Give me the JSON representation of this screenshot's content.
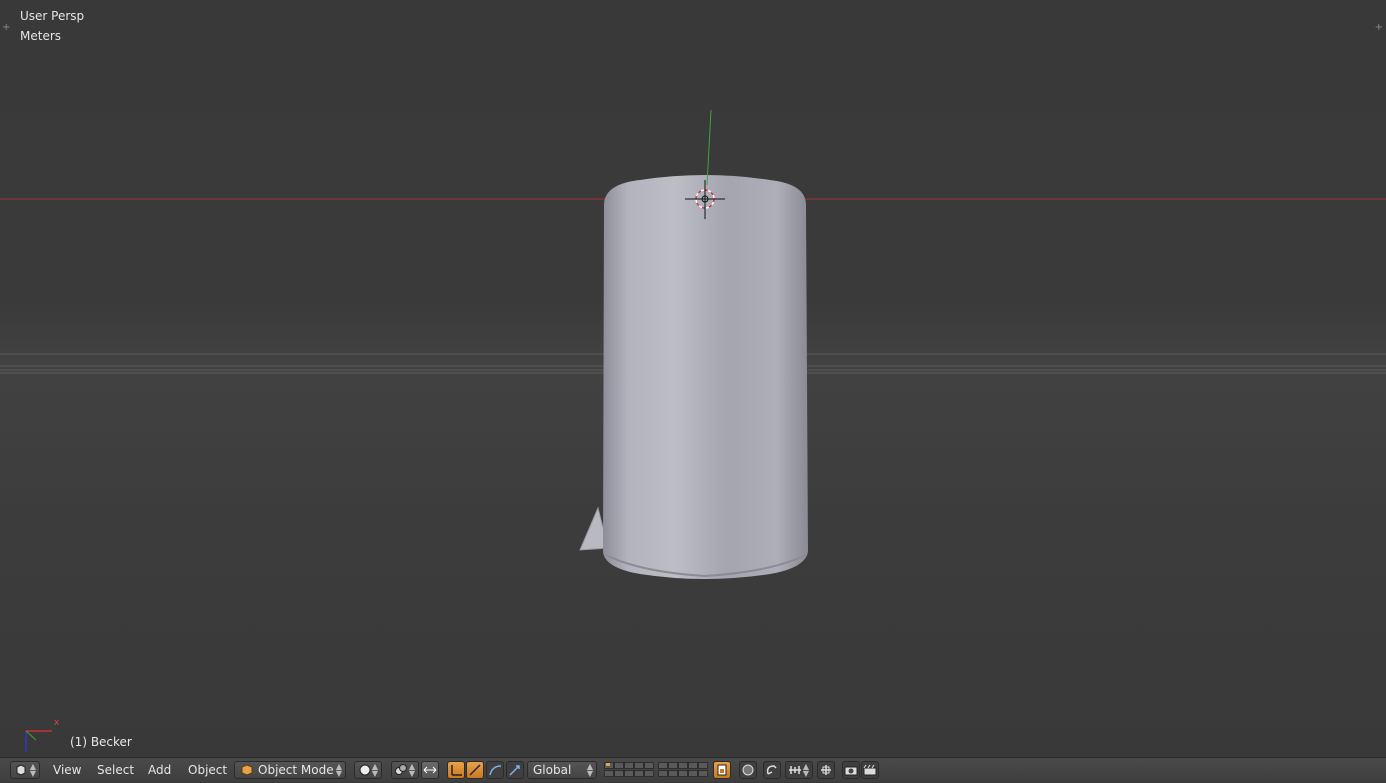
{
  "viewport": {
    "title": "User Persp",
    "units": "Meters",
    "object_name": "(1) Becker",
    "axis_label": "x",
    "colors": {
      "x_axis": "#a33434",
      "y_axis": "#3ea33e",
      "background": "#393939"
    }
  },
  "header": {
    "menus": [
      "View",
      "Select",
      "Add",
      "Object"
    ],
    "mode": "Object Mode",
    "orientation": "Global",
    "icons": [
      "editor-type-icon",
      "mode-cube-icon",
      "viewport-shading-icon",
      "pivot-point-icon",
      "manipulator-toggle-icon",
      "translate-icon",
      "rotate-icon",
      "scale-icon",
      "layer-grid-icon",
      "lock-camera-icon",
      "proportional-edit-icon",
      "snap-icon",
      "snap-element-icon",
      "opengl-render-icon",
      "render-animation-icon"
    ]
  }
}
